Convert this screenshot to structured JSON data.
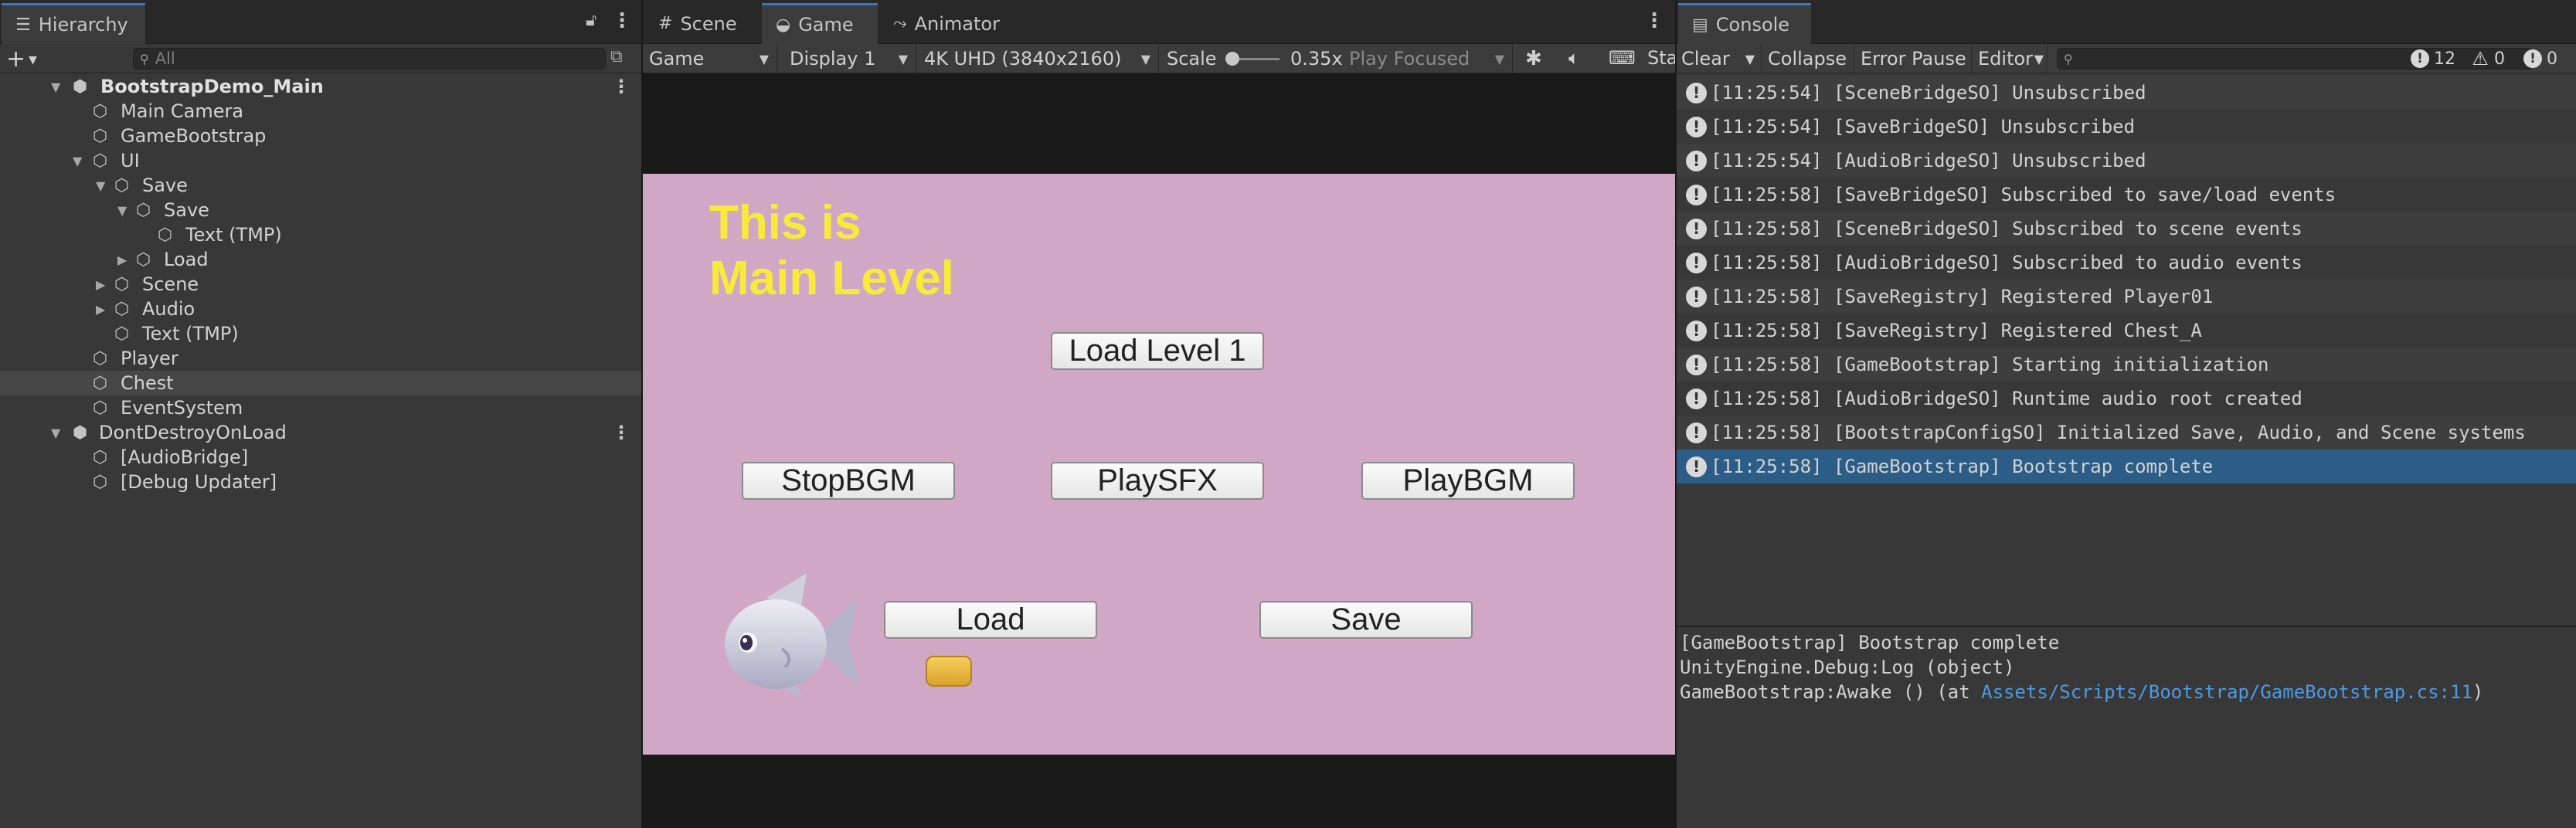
{
  "hierarchy": {
    "tab_label": "Hierarchy",
    "search_placeholder": "All",
    "rows": [
      {
        "label": "BootstrapDemo_Main"
      },
      {
        "label": "Main Camera"
      },
      {
        "label": "GameBootstrap"
      },
      {
        "label": "UI"
      },
      {
        "label": "Save"
      },
      {
        "label": "Save"
      },
      {
        "label": "Text (TMP)"
      },
      {
        "label": "Load"
      },
      {
        "label": "Scene"
      },
      {
        "label": "Audio"
      },
      {
        "label": "Text (TMP)"
      },
      {
        "label": "Player"
      },
      {
        "label": "Chest"
      },
      {
        "label": "EventSystem"
      },
      {
        "label": "DontDestroyOnLoad"
      },
      {
        "label": "[AudioBridge]"
      },
      {
        "label": "[Debug Updater]"
      }
    ]
  },
  "game": {
    "tabs": [
      {
        "label": "Scene"
      },
      {
        "label": "Game"
      },
      {
        "label": "Animator"
      }
    ],
    "toolbar": {
      "mode": "Game",
      "display": "Display 1",
      "resolution": "4K UHD (3840x2160)",
      "scale_label": "Scale",
      "scale_value": "0.35x",
      "play_mode": "Play Focused",
      "stats_label": "Sta"
    },
    "view": {
      "title": "This is\nMain Level",
      "buttons": {
        "load_level": "Load Level 1",
        "stop_bgm": "StopBGM",
        "play_sfx": "PlaySFX",
        "play_bgm": "PlayBGM",
        "load": "Load",
        "save": "Save"
      }
    }
  },
  "console": {
    "tab_label": "Console",
    "toolbar": {
      "clear": "Clear",
      "collapse": "Collapse",
      "error_pause": "Error Pause",
      "editor": "Editor",
      "log_count": "12",
      "warn_count": "0",
      "error_count": "0"
    },
    "logs": [
      {
        "text": "[11:25:54] [SceneBridgeSO] Unsubscribed"
      },
      {
        "text": "[11:25:54] [SaveBridgeSO] Unsubscribed"
      },
      {
        "text": "[11:25:54] [AudioBridgeSO] Unsubscribed"
      },
      {
        "text": "[11:25:58] [SaveBridgeSO] Subscribed to save/load events"
      },
      {
        "text": "[11:25:58] [SceneBridgeSO] Subscribed to scene events"
      },
      {
        "text": "[11:25:58] [AudioBridgeSO] Subscribed to audio events"
      },
      {
        "text": "[11:25:58] [SaveRegistry] Registered Player01"
      },
      {
        "text": "[11:25:58] [SaveRegistry] Registered Chest_A"
      },
      {
        "text": "[11:25:58] [GameBootstrap] Starting initialization"
      },
      {
        "text": "[11:25:58] [AudioBridgeSO] Runtime audio root created"
      },
      {
        "text": "[11:25:58] [BootstrapConfigSO] Initialized Save, Audio, and Scene systems"
      },
      {
        "text": "[11:25:58] [GameBootstrap] Bootstrap complete"
      }
    ],
    "detail": {
      "line1": "[GameBootstrap] Bootstrap complete",
      "line2": "UnityEngine.Debug:Log (object)",
      "line3_prefix": "GameBootstrap:Awake () (at ",
      "line3_link": "Assets/Scripts/Bootstrap/GameBootstrap.cs:11",
      "line3_suffix": ")"
    }
  }
}
